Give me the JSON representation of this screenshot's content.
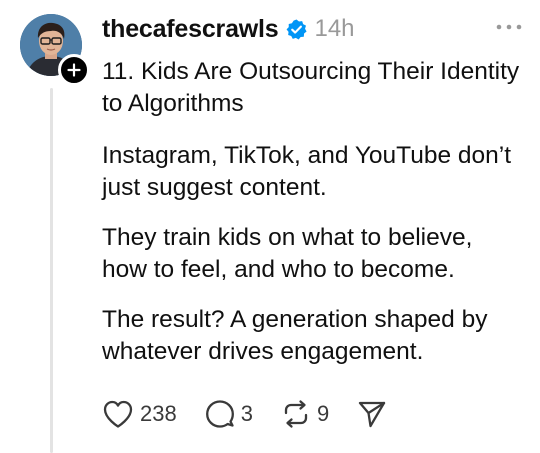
{
  "post": {
    "username": "thecafescrawls",
    "timestamp": "14h",
    "paragraphs": [
      "11. Kids Are Outsourcing Their Identity to Algorithms",
      "Instagram, TikTok, and YouTube don’t just suggest content.",
      "They train kids on what to believe, how to feel, and who to become.",
      "The result? A generation shaped by whatever drives engagement."
    ],
    "actions": {
      "likes": "238",
      "replies": "3",
      "reposts": "9"
    }
  },
  "icons": {
    "avatar": "avatar-photo",
    "follow": "plus-icon",
    "verified": "verified-badge-icon",
    "more": "more-horizontal-icon",
    "like": "heart-icon",
    "reply": "comment-icon",
    "repost": "repost-icon",
    "share": "send-icon"
  },
  "colors": {
    "verified_blue": "#0095f6",
    "text": "#101010",
    "muted": "#999999"
  }
}
